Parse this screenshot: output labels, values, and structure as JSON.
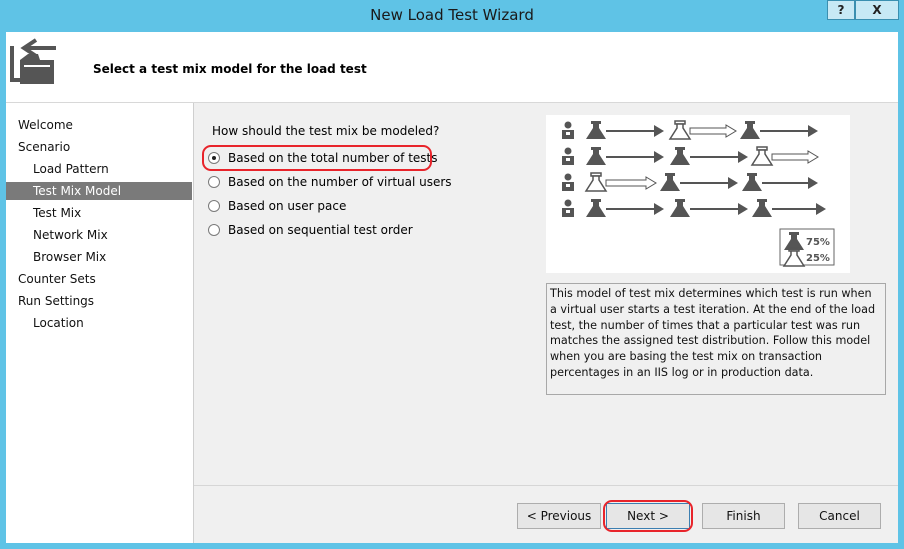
{
  "window": {
    "title": "New Load Test Wizard",
    "help_label": "?",
    "close_label": "X"
  },
  "header": {
    "title": "Select a test mix model for the load test",
    "icon": "wizard-folder-icon"
  },
  "nav": {
    "items": [
      {
        "label": "Welcome",
        "indent": 0,
        "selected": false
      },
      {
        "label": "Scenario",
        "indent": 0,
        "selected": false
      },
      {
        "label": "Load Pattern",
        "indent": 1,
        "selected": false
      },
      {
        "label": "Test Mix Model",
        "indent": 1,
        "selected": true
      },
      {
        "label": "Test Mix",
        "indent": 1,
        "selected": false
      },
      {
        "label": "Network Mix",
        "indent": 1,
        "selected": false
      },
      {
        "label": "Browser Mix",
        "indent": 1,
        "selected": false
      },
      {
        "label": "Counter Sets",
        "indent": 0,
        "selected": false
      },
      {
        "label": "Run Settings",
        "indent": 0,
        "selected": false
      },
      {
        "label": "Location",
        "indent": 1,
        "selected": false
      }
    ]
  },
  "content": {
    "question": "How should the test mix be modeled?",
    "options": [
      {
        "label": "Based on the total number of tests",
        "checked": true
      },
      {
        "label": "Based on the number of virtual users",
        "checked": false
      },
      {
        "label": "Based on user pace",
        "checked": false
      },
      {
        "label": "Based on sequential test order",
        "checked": false
      }
    ],
    "diagram": {
      "legend_filled": "75%",
      "legend_outline": "25%"
    },
    "description": "This model of test mix determines which test is run when a virtual user starts a test iteration. At the end of the load test, the number of times that a particular test was run matches the assigned test distribution. Follow this model when you are basing the test mix on transaction percentages in an IIS log or in production data."
  },
  "buttons": {
    "previous": "< Previous",
    "next": "Next >",
    "finish": "Finish",
    "cancel": "Cancel"
  },
  "colors": {
    "highlight": "#e8242b",
    "selected_nav": "#7a7a7a",
    "titlebar": "#5fc3e6"
  }
}
